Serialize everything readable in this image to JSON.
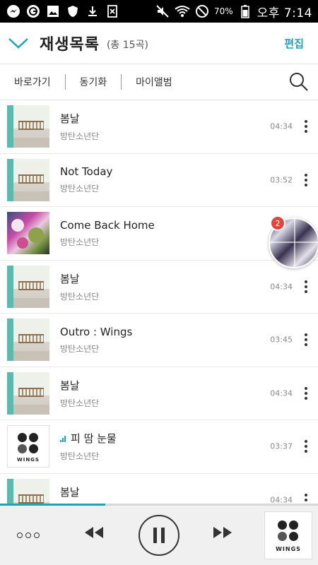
{
  "status_bar": {
    "battery": "70%",
    "time": "오후 7:14",
    "icons": [
      "messenger-icon",
      "g-app-icon",
      "gallery-icon",
      "shield-icon",
      "download-icon",
      "file-icon",
      "mute-icon",
      "wifi-icon",
      "no-sign-icon",
      "battery-icon"
    ]
  },
  "header": {
    "title": "재생목록",
    "count": "(총 15곡)",
    "edit_label": "편집"
  },
  "nav": {
    "items": [
      "바로가기",
      "동기화",
      "마이앨범"
    ]
  },
  "songs": [
    {
      "title": "봄날",
      "artist": "방탄소년단",
      "duration": "04:34",
      "art": "spring-day"
    },
    {
      "title": "Not Today",
      "artist": "방탄소년단",
      "duration": "03:52",
      "art": "spring-day"
    },
    {
      "title": "Come Back Home",
      "artist": "방탄소년단",
      "duration": "",
      "art": "come-back-home"
    },
    {
      "title": "봄날",
      "artist": "방탄소년단",
      "duration": "04:34",
      "art": "spring-day"
    },
    {
      "title": "Outro : Wings",
      "artist": "방탄소년단",
      "duration": "03:45",
      "art": "spring-day"
    },
    {
      "title": "봄날",
      "artist": "방탄소년단",
      "duration": "04:34",
      "art": "spring-day"
    },
    {
      "title": "피 땀 눈물",
      "artist": "방탄소년단",
      "duration": "03:37",
      "art": "wings",
      "playing": true
    },
    {
      "title": "봄날",
      "artist": "방탄소년단",
      "duration": "04:34",
      "art": "spring-day"
    }
  ],
  "album_text": "WINGS",
  "bubble": {
    "badge": "2"
  },
  "player": {
    "progress": 0.33
  },
  "colors": {
    "accent": "#1aa6b7",
    "badge": "#e0463c"
  }
}
